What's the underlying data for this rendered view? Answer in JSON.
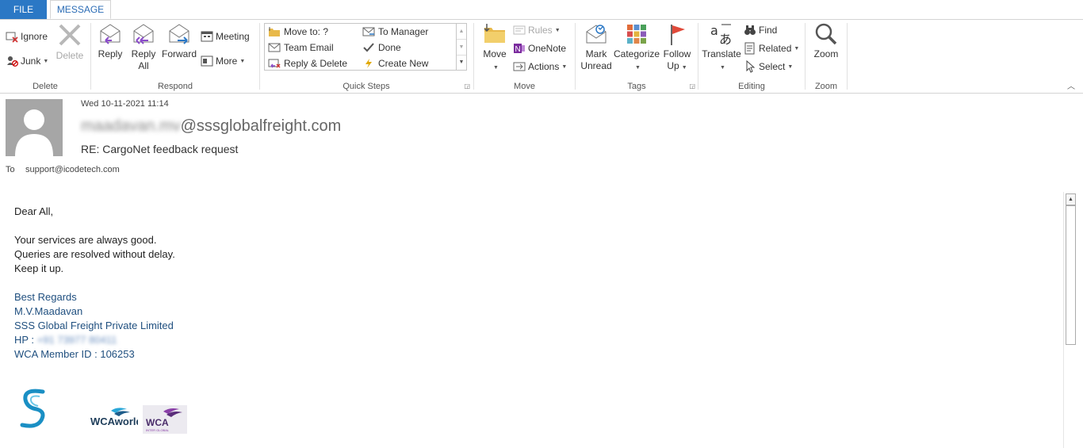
{
  "tabs": {
    "file": "FILE",
    "message": "MESSAGE"
  },
  "ribbon": {
    "delete": {
      "ignore": "Ignore",
      "junk": "Junk",
      "delete": "Delete",
      "label": "Delete"
    },
    "respond": {
      "reply": "Reply",
      "reply_all_1": "Reply",
      "reply_all_2": "All",
      "forward": "Forward",
      "meeting": "Meeting",
      "more": "More",
      "label": "Respond"
    },
    "quick_steps": {
      "items": [
        "Move to: ?",
        "Team Email",
        "Reply & Delete",
        "To Manager",
        "Done",
        "Create New"
      ],
      "label": "Quick Steps"
    },
    "move": {
      "move": "Move",
      "rules": "Rules",
      "onenote": "OneNote",
      "actions": "Actions",
      "label": "Move"
    },
    "tags": {
      "mark_unread_1": "Mark",
      "mark_unread_2": "Unread",
      "categorize": "Categorize",
      "follow_up_1": "Follow",
      "follow_up_2": "Up",
      "label": "Tags"
    },
    "editing": {
      "translate": "Translate",
      "find": "Find",
      "related": "Related",
      "select": "Select",
      "label": "Editing"
    },
    "zoom": {
      "zoom": "Zoom",
      "label": "Zoom"
    }
  },
  "message": {
    "date": "Wed 10-11-2021 11:14",
    "from_name_blurred": "maadavan.mv",
    "from_domain": "@sssglobalfreight.com",
    "subject": "RE: CargoNet feedback request",
    "to_label": "To",
    "to_value": "support@icodetech.com",
    "body": {
      "greeting": "Dear All,",
      "lines": [
        "Your services are always good.",
        "Queries are resolved without delay.",
        "Keep it up."
      ],
      "sign_regards": "Best Regards",
      "sign_name": "M.V.Maadavan",
      "sign_company": "SSS Global Freight Private Limited",
      "sign_hp_label": "HP :",
      "sign_hp_value": "+91 73977 80411",
      "sign_wca": "WCA Member ID : 106253"
    }
  },
  "logos": {
    "wca_world": "WCAworld",
    "wca_inter": "WCA",
    "wca_inter_sub": "INTER GLOBAL"
  },
  "colors": {
    "file_tab": "#2b78c5",
    "tab_text": "#2b6cb5",
    "signature": "#1f4f7f"
  }
}
